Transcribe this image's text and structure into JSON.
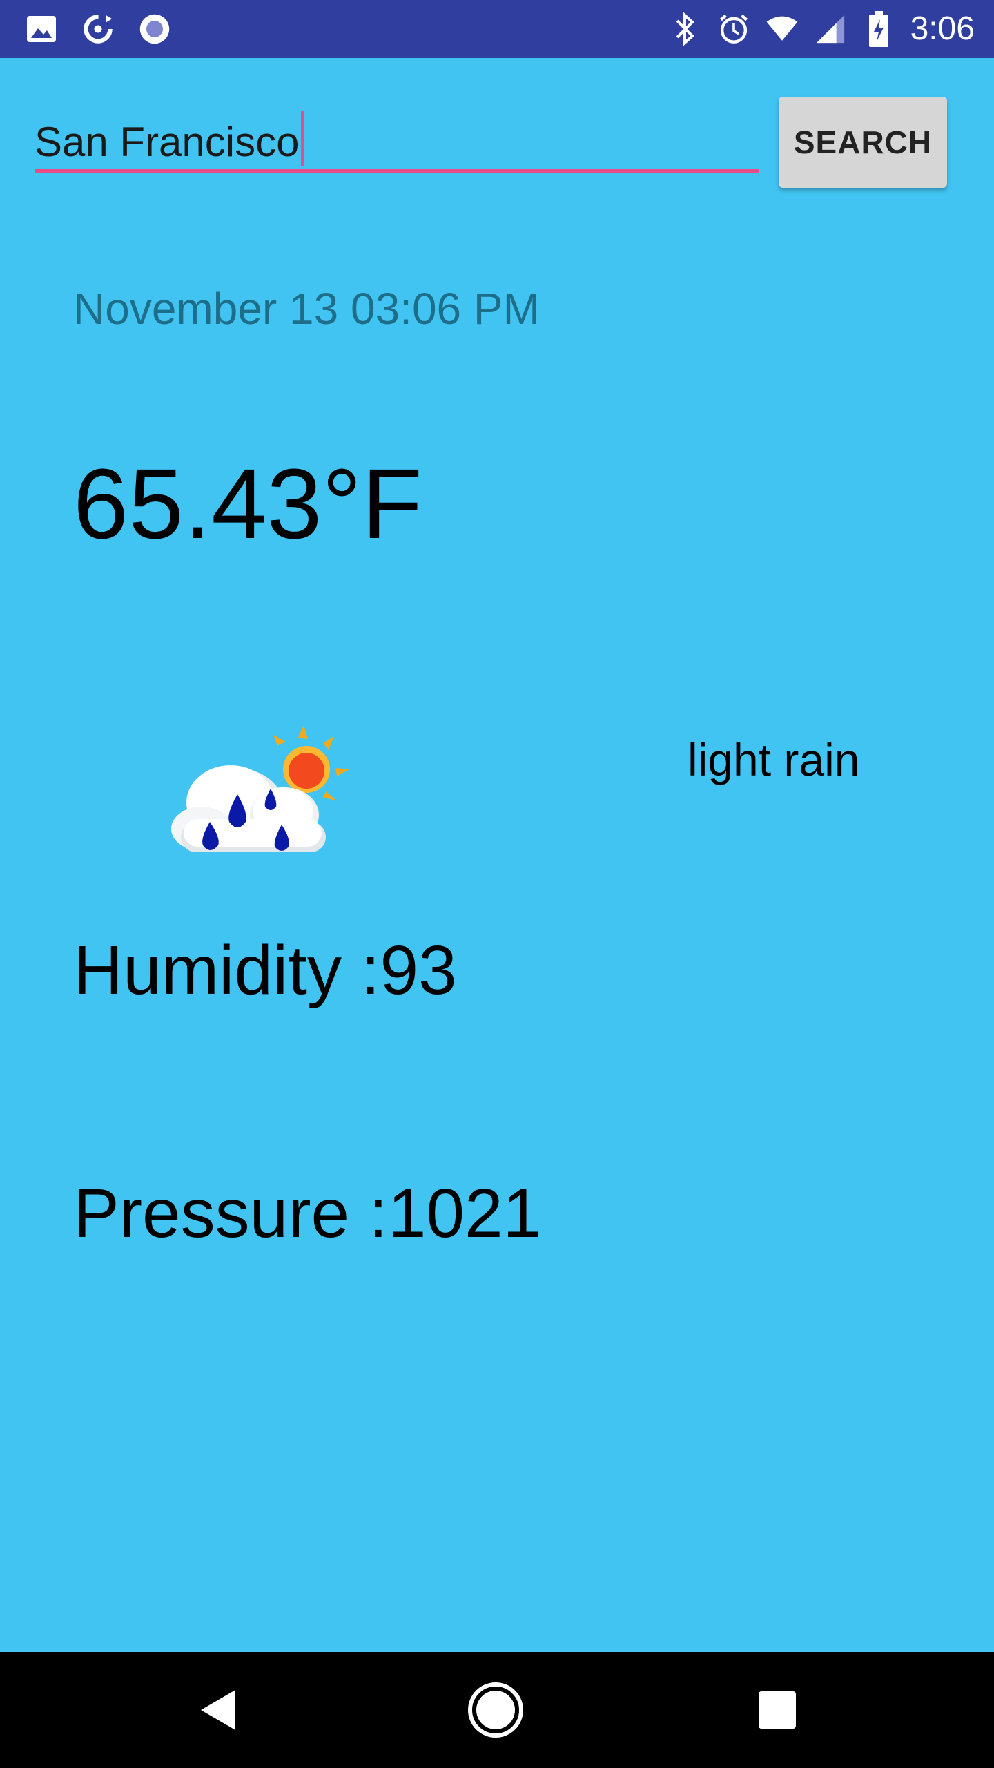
{
  "status_bar": {
    "time": "3:06",
    "left_icons": [
      "image-icon",
      "sync-icon",
      "record-icon"
    ],
    "right_icons": [
      "bluetooth-icon",
      "alarm-icon",
      "wifi-icon",
      "signal-icon",
      "battery-charging-icon"
    ]
  },
  "search": {
    "value": "San Francisco",
    "button_label": "SEARCH",
    "accent_color": "#E94D86"
  },
  "weather": {
    "date": "November 13 03:06 PM",
    "temperature": "65.43°F",
    "description": "light rain",
    "icon": "light-rain-icon",
    "humidity": "Humidity :93",
    "pressure": "Pressure :1021"
  },
  "colors": {
    "background": "#41C4F2",
    "status_bar": "#303F9F"
  },
  "nav_bar": {
    "buttons": [
      "back-icon",
      "home-icon",
      "recents-icon"
    ]
  }
}
